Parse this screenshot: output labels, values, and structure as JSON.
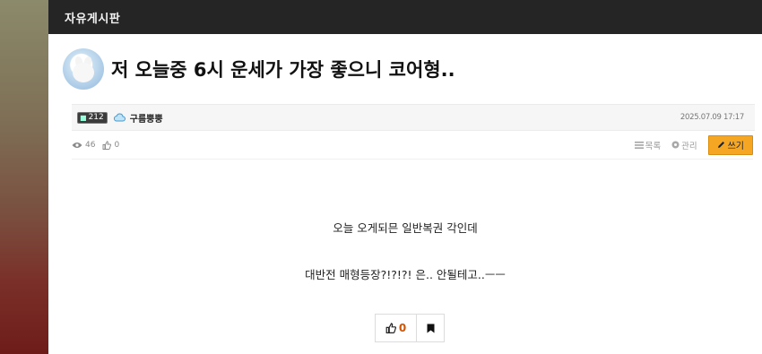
{
  "board": {
    "name": "자유게시판"
  },
  "post": {
    "title": "저 오늘중 6시 운세가 가장 좋으니 코어형..",
    "author": {
      "level": "212",
      "nickname": "구름뿡뿡"
    },
    "date": "2025.07.09 17:17",
    "views": "46",
    "likes": "0",
    "body_lines": [
      "오늘 오게되믄 일반복권 각인데",
      "대반전 매형등장?!?!?!   은.. 안될테고..ㅡㅡ"
    ]
  },
  "actions": {
    "list_label": "목록",
    "manage_label": "관리",
    "write_label": "쓰기"
  },
  "vote": {
    "like_count": "0"
  },
  "colors": {
    "accent": "#f5a623",
    "topbar": "#252525",
    "like": "#d35400"
  },
  "icons": [
    "eye-icon",
    "thumbs-up-icon",
    "list-icon",
    "gear-icon",
    "pencil-icon",
    "bookmark-icon",
    "cloud-icon",
    "level-icon"
  ]
}
